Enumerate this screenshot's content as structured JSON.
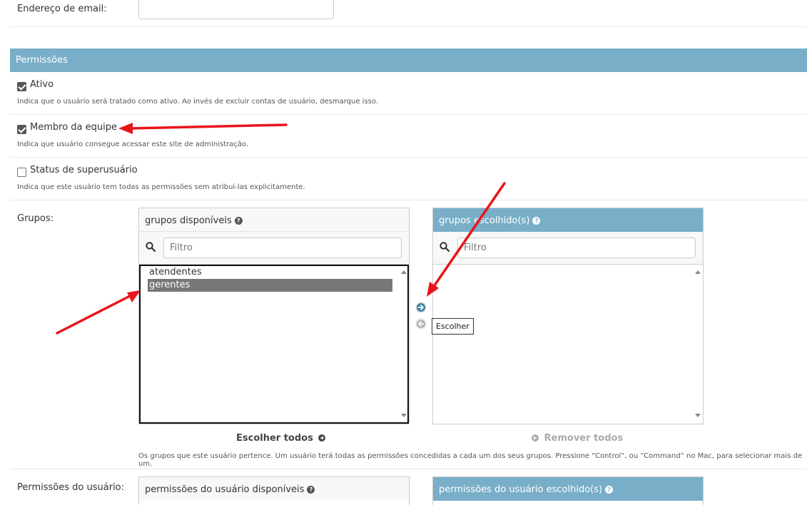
{
  "email": {
    "label": "Endereço de email:",
    "value": ""
  },
  "permissions": {
    "header": "Permissões",
    "active": {
      "label": "Ativo",
      "checked": true,
      "help": "Indica que o usuário será tratado como ativo. Ao invés de excluir contas de usuário, desmarque isso."
    },
    "staff": {
      "label": "Membro da equipe",
      "checked": true,
      "help": "Indica que usuário consegue acessar este site de administração."
    },
    "superuser": {
      "label": "Status de superusuário",
      "checked": false,
      "help": "Indica que este usuário tem todas as permissões sem atribuí-las explicitamente."
    }
  },
  "groups": {
    "label": "Grupos:",
    "available_title": "grupos disponíveis",
    "chosen_title": "grupos escolhido(s)",
    "filter_placeholder": "Filtro",
    "available_options": [
      "atendentes",
      "gerentes"
    ],
    "selected_option": "gerentes",
    "chosen_options": [],
    "tooltip": "Escolher",
    "choose_all": "Escolher todos",
    "remove_all": "Remover todos",
    "help": "Os grupos que este usuário pertence. Um usuário terá todas as permissões concedidas a cada um dos seus grupos. Pressione “Control”, ou “Command” no Mac, para selecionar mais de um."
  },
  "user_permissions": {
    "label": "Permissões do usuário:",
    "available_title": "permissões do usuário disponíveis",
    "chosen_title": "permissões do usuário escolhido(s)"
  },
  "help_icon_glyph": "?",
  "colors": {
    "header_bg": "#79aec8",
    "selected_option_bg": "#777777",
    "annotation_arrow": "#e8151b",
    "checkbox_checked": "#575757"
  }
}
